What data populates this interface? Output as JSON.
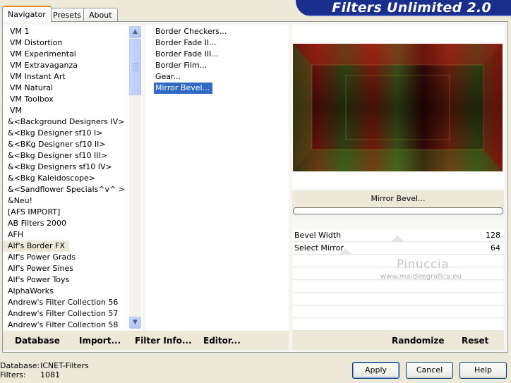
{
  "tabs": [
    "Navigator",
    "Presets",
    "About"
  ],
  "banner": {
    "title": "Filters Unlimited 2.0"
  },
  "categories": [
    "VM 1",
    "VM Distortion",
    "VM Experimental",
    "VM Extravaganza",
    "VM Instant Art",
    "VM Natural",
    "VM Toolbox",
    "VM",
    "&<Background Designers IV>",
    "&<Bkg Designer sf10 I>",
    "&<BKg Designer sf10 II>",
    "&<Bkg Designer sf10 III>",
    "&<Bkg Designers sf10 IV>",
    "&<Bkg Kaleidoscope>",
    "&<Sandflower Specials^v^ >",
    "&Neu!",
    "[AFS IMPORT]",
    "AB Filters 2000",
    "AFH",
    "Alf's Border FX",
    "Alf's Power Grads",
    "Alf's Power Sines",
    "Alf's Power Toys",
    "AlphaWorks",
    "Andrew's Filter Collection 56",
    "Andrew's Filter Collection 57",
    "Andrew's Filter Collection 58"
  ],
  "filters": [
    "Border Checkers...",
    "Border Fade II...",
    "Border Fade III...",
    "Border Film...",
    "Gear...",
    "Mirror Bevel..."
  ],
  "selected_filter_label": "Mirror Bevel...",
  "controls": [
    {
      "label": "Bevel Width",
      "value": "128"
    },
    {
      "label": "Select Mirror",
      "value": "64"
    }
  ],
  "watermark": {
    "name": "Pinuccia",
    "url": "www.maidiregrafica.eu"
  },
  "links": {
    "database": "Database",
    "import": "Import...",
    "filter_info": "Filter Info...",
    "editor": "Editor...",
    "randomize": "Randomize",
    "reset": "Reset"
  },
  "status": {
    "database_label": "Database:",
    "database_value": "ICNET-Filters",
    "filters_label": "Filters:",
    "filters_value": "1081"
  },
  "buttons": {
    "apply": "Apply",
    "cancel": "Cancel",
    "help": "Help"
  },
  "colors": {
    "selection": "#316ac5",
    "banner": "#1a2e8c",
    "tab_accent": "#e68b2c"
  }
}
